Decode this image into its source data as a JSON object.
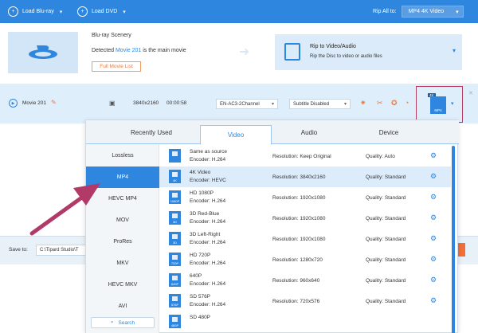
{
  "topbar": {
    "load_bluray": "Load Blu-ray",
    "load_dvd": "Load DVD",
    "rip_all_label": "Rip All to:",
    "rip_all_value": "MP4 4K Video"
  },
  "source": {
    "title": "Blu-ray Scenery",
    "detected_prefix": "Detected ",
    "detected_movie": "Movie 201",
    "detected_suffix": " is the main movie",
    "full_list_label": "Full Movie List",
    "rip_target_title": "Rip to Video/Audio",
    "rip_target_sub": "Rip the Disc to video or audio files"
  },
  "movie": {
    "name": "Movie 201",
    "resolution": "3840x2160",
    "duration": "00:00:58",
    "audio_track": "EN-AC3-2Channel",
    "subtitle": "Subtitle Disabled",
    "format_tag": "4K",
    "format_label": "MP4"
  },
  "save": {
    "label": "Save to:",
    "path": "C:\\Tipard Studio\\T"
  },
  "dropdown": {
    "tabs": [
      "Recently Used",
      "Video",
      "Audio",
      "Device"
    ],
    "active_tab": "Video",
    "categories": [
      "Lossless",
      "MP4",
      "HEVC MP4",
      "MOV",
      "ProRes",
      "MKV",
      "HEVC MKV",
      "AVI"
    ],
    "active_category": "MP4",
    "search_label": "Search",
    "options": [
      {
        "icon_tag": "",
        "name": "Same as source",
        "encoder": "Encoder: H.264",
        "resolution": "Resolution: Keep Original",
        "quality": "Quality: Auto"
      },
      {
        "icon_tag": "4K",
        "name": "4K Video",
        "encoder": "Encoder: HEVC",
        "resolution": "Resolution: 3840x2160",
        "quality": "Quality: Standard"
      },
      {
        "icon_tag": "1080P",
        "name": "HD 1080P",
        "encoder": "Encoder: H.264",
        "resolution": "Resolution: 1920x1080",
        "quality": "Quality: Standard"
      },
      {
        "icon_tag": "3D",
        "name": "3D Red-Blue",
        "encoder": "Encoder: H.264",
        "resolution": "Resolution: 1920x1080",
        "quality": "Quality: Standard"
      },
      {
        "icon_tag": "3D",
        "name": "3D Left-Right",
        "encoder": "Encoder: H.264",
        "resolution": "Resolution: 1920x1080",
        "quality": "Quality: Standard"
      },
      {
        "icon_tag": "720P",
        "name": "HD 720P",
        "encoder": "Encoder: H.264",
        "resolution": "Resolution: 1280x720",
        "quality": "Quality: Standard"
      },
      {
        "icon_tag": "640P",
        "name": "640P",
        "encoder": "Encoder: H.264",
        "resolution": "Resolution: 960x640",
        "quality": "Quality: Standard"
      },
      {
        "icon_tag": "576P",
        "name": "SD 576P",
        "encoder": "Encoder: H.264",
        "resolution": "Resolution: 720x576",
        "quality": "Quality: Standard"
      },
      {
        "icon_tag": "480P",
        "name": "SD 480P",
        "encoder": "",
        "resolution": "",
        "quality": ""
      }
    ],
    "selected_option": 1
  },
  "colors": {
    "accent": "#2f86de",
    "highlight_border": "#b43b5c",
    "arrow": "#b13a68",
    "orange": "#ee7a3c"
  }
}
